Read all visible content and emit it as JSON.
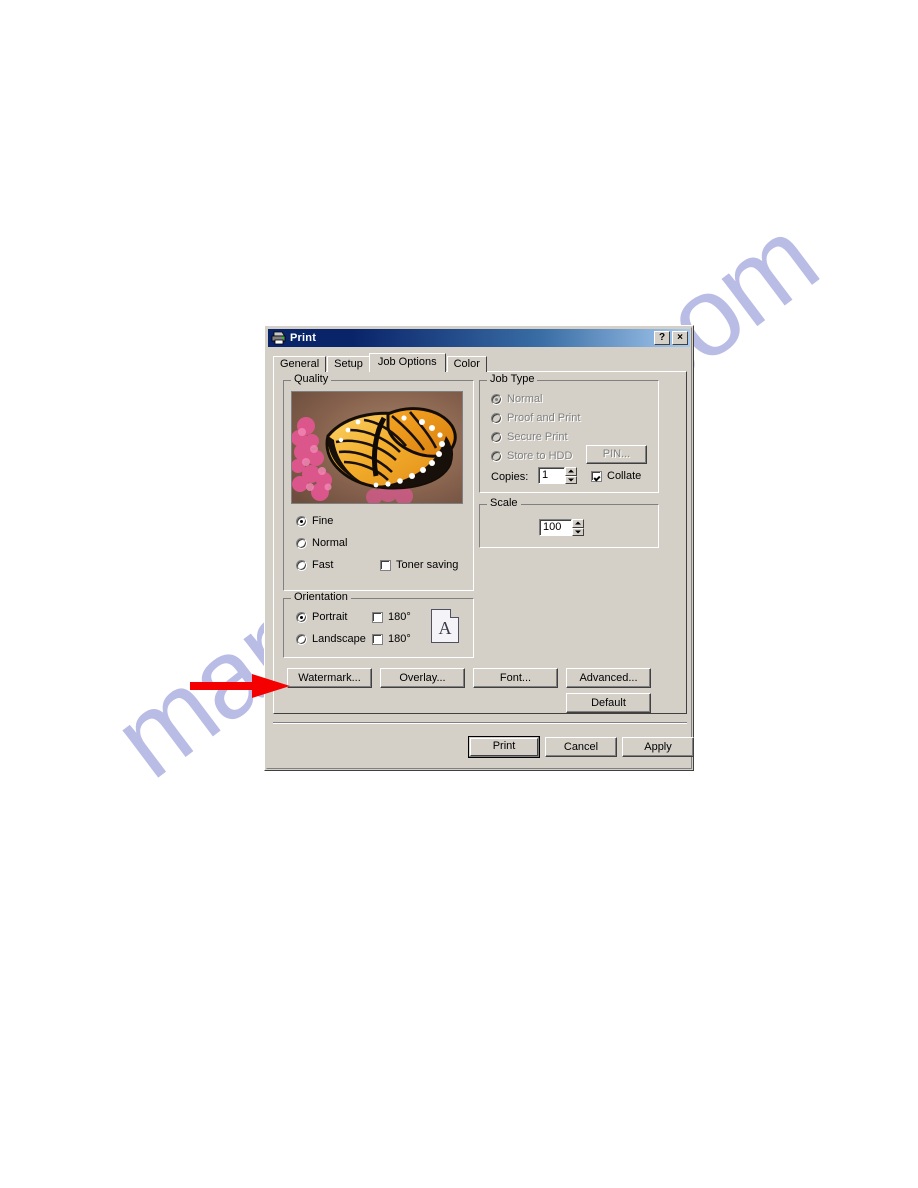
{
  "page": {
    "background_color": "#ffffff",
    "watermark_text": "manualshive.com",
    "watermark_color": "#b9bce4"
  },
  "callout": {
    "name": "red-arrow",
    "color": "#f40000",
    "points_to": "Watermark... button"
  },
  "dialog": {
    "title": "Print",
    "icon": "printer-icon",
    "titlebar_buttons": [
      {
        "name": "help-button",
        "label": "?"
      },
      {
        "name": "close-button",
        "label": "×"
      }
    ],
    "tabs": [
      {
        "label": "General",
        "active": false
      },
      {
        "label": "Setup",
        "active": false
      },
      {
        "label": "Job Options",
        "active": true
      },
      {
        "label": "Color",
        "active": false
      }
    ],
    "quality": {
      "group_label": "Quality",
      "preview_image": "monarch-butterfly-on-pink-flowers",
      "options": [
        {
          "label": "Fine",
          "selected": true
        },
        {
          "label": "Normal",
          "selected": false
        },
        {
          "label": "Fast",
          "selected": false
        }
      ],
      "toner_saving": {
        "label": "Toner saving",
        "checked": false
      }
    },
    "orientation": {
      "group_label": "Orientation",
      "options": [
        {
          "label": "Portrait",
          "selected": true,
          "rotate_label": "180°",
          "rotate_checked": false
        },
        {
          "label": "Landscape",
          "selected": false,
          "rotate_label": "180°",
          "rotate_checked": false
        }
      ],
      "preview_glyph": "A"
    },
    "job_type": {
      "group_label": "Job Type",
      "options": [
        {
          "label": "Normal",
          "selected": true,
          "disabled": true
        },
        {
          "label": "Proof and Print",
          "selected": false,
          "disabled": true
        },
        {
          "label": "Secure Print",
          "selected": false,
          "disabled": true
        },
        {
          "label": "Store to HDD",
          "selected": false,
          "disabled": true
        }
      ],
      "pin_button": {
        "label": "PIN...",
        "disabled": true
      },
      "copies": {
        "label": "Copies:",
        "value": "1"
      },
      "collate": {
        "label": "Collate",
        "checked": true
      }
    },
    "scale": {
      "group_label": "Scale",
      "value": "100"
    },
    "option_buttons": [
      {
        "label": "Watermark..."
      },
      {
        "label": "Overlay..."
      },
      {
        "label": "Font..."
      },
      {
        "label": "Advanced..."
      }
    ],
    "default_button": {
      "label": "Default"
    },
    "action_buttons": [
      {
        "label": "Print",
        "default": true
      },
      {
        "label": "Cancel",
        "default": false
      },
      {
        "label": "Apply",
        "default": false
      }
    ]
  }
}
